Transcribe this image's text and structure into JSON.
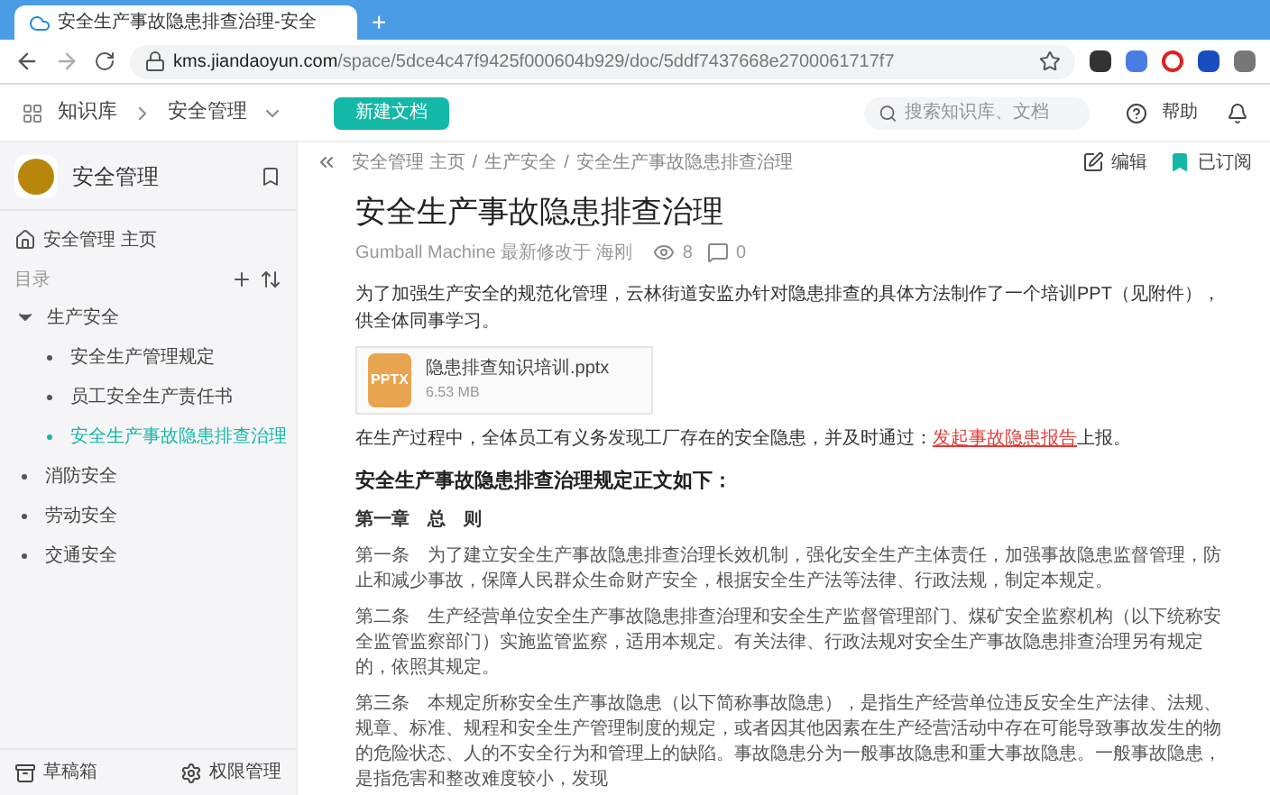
{
  "browser": {
    "tab_title": "安全生产事故隐患排查治理-安全",
    "new_tab": "+",
    "url_host": "kms.jiandaoyun.com",
    "url_path": "/space/5dce4c47f9425f000604b929/doc/5ddf7437668e2700061717f7"
  },
  "header": {
    "breadcrumb": [
      "知识库",
      "安全管理"
    ],
    "new_button": "新建文档",
    "search_placeholder": "搜索知识库、文档",
    "help": "帮助"
  },
  "sidebar": {
    "space_name": "安全管理",
    "home": "安全管理 主页",
    "toc_label": "目录",
    "tree": [
      {
        "label": "生产安全",
        "expanded": true,
        "selected": false,
        "children": [
          {
            "label": "安全生产管理规定",
            "expanded": false,
            "selected": false
          },
          {
            "label": "员工安全生产责任书",
            "expanded": false,
            "selected": false
          },
          {
            "label": "安全生产事故隐患排查治理",
            "expanded": false,
            "selected": true
          }
        ]
      },
      {
        "label": "消防安全",
        "expanded": false,
        "selected": false
      },
      {
        "label": "劳动安全",
        "expanded": false,
        "selected": false
      },
      {
        "label": "交通安全",
        "expanded": false,
        "selected": false
      }
    ],
    "footer": [
      {
        "kind": "drafts",
        "label": "草稿箱"
      },
      {
        "kind": "permissions",
        "label": "权限管理"
      }
    ]
  },
  "doc": {
    "breadcrumb": [
      "安全管理 主页",
      "生产安全",
      "安全生产事故隐患排查治理"
    ],
    "breadcrumb_separator": "/",
    "edit": "编辑",
    "subscribe": {
      "label": "已订阅",
      "on": true
    },
    "title": "安全生产事故隐患排查治理",
    "author": "Gumball Machine",
    "modified": "最新修改于 海刚",
    "views": "8",
    "comments": "0",
    "intro": "为了加强生产安全的规范化管理，云林街道安监办针对隐患排查的具体方法制作了一个培训PPT（见附件），供全体同事学习。",
    "attachment": {
      "badge": "PPTX",
      "name": "隐患排查知识培训.pptx",
      "size": "6.53 MB"
    },
    "report": {
      "before": "在生产过程中，全体员工有义务发现工厂存在的安全隐患，并及时通过：",
      "link": "发起事故隐患报告",
      "after": "上报。"
    },
    "heading": "安全生产事故隐患排查治理规定正文如下：",
    "chapter": "第一章　总　则",
    "articles": [
      "第一条　为了建立安全生产事故隐患排查治理长效机制，强化安全生产主体责任，加强事故隐患监督管理，防止和减少事故，保障人民群众生命财产安全，根据安全生产法等法律、行政法规，制定本规定。",
      "第二条　生产经营单位安全生产事故隐患排查治理和安全生产监督管理部门、煤矿安全监察机构（以下统称安全监管监察部门）实施监管监察，适用本规定。有关法律、行政法规对安全生产事故隐患排查治理另有规定的，依照其规定。",
      "第三条　本规定所称安全生产事故隐患（以下简称事故隐患），是指生产经营单位违反安全生产法律、法规、规章、标准、规程和安全生产管理制度的规定，或者因其他因素在生产经营活动中存在可能导致事故发生的物的危险状态、人的不安全行为和管理上的缺陷。事故隐患分为一般事故隐患和重大事故隐患。一般事故隐患，是指危害和整改难度较小，发现"
    ]
  }
}
